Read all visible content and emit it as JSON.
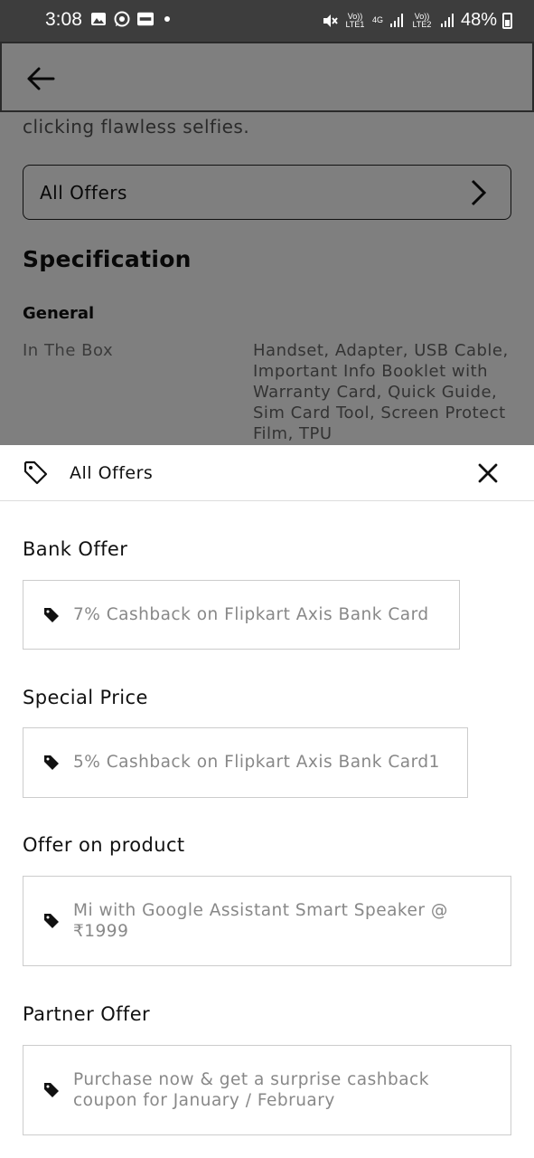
{
  "status_bar": {
    "time": "3:08",
    "left_icons": [
      "gallery-icon",
      "whatsapp-icon",
      "paytm-icon",
      "notification-dot-icon"
    ],
    "sim1_label": "Vo)) LTE1",
    "network_type": "4G",
    "sim2_label": "Vo)) LTE2",
    "battery": "48%"
  },
  "background_page": {
    "description_tail": "clicking flawless selfies.",
    "all_offers_label": "All Offers",
    "specification_title": "Specification",
    "general_label": "General",
    "in_the_box_key": "In The Box",
    "in_the_box_value": "Handset, Adapter, USB Cable, Important Info Booklet with Warranty Card, Quick Guide, Sim Card Tool, Screen Protect Film, TPU"
  },
  "sheet": {
    "title": "All Offers",
    "sections": [
      {
        "title": "Bank Offer",
        "offer": "7% Cashback on Flipkart Axis Bank Card"
      },
      {
        "title": "Special Price",
        "offer": "5% Cashback on Flipkart Axis Bank Card1"
      },
      {
        "title": "Offer on product",
        "offer": "Mi with Google Assistant Smart Speaker @ ₹1999"
      },
      {
        "title": "Partner Offer",
        "offer": "Purchase now & get a surprise cashback coupon for January / February"
      }
    ]
  },
  "colors": {
    "status_bar_bg": "#3d3d3d",
    "scrim": "rgba(0,0,0,0.5)",
    "offer_text": "#888888",
    "card_border": "#cccccc"
  }
}
